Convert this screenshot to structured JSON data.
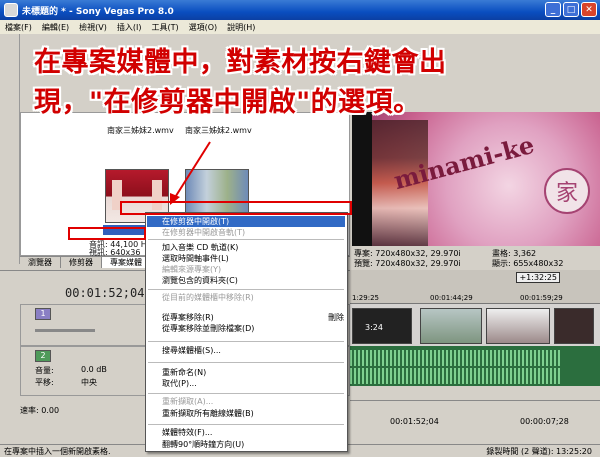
{
  "window": {
    "title": "未標題的 * - Sony Vegas Pro 8.0",
    "minimize": "_",
    "maximize": "□",
    "close": "✕"
  },
  "menubar": [
    "檔案(F)",
    "編輯(E)",
    "檢視(V)",
    "插入(I)",
    "工具(T)",
    "選項(O)",
    "說明(H)"
  ],
  "annotation": {
    "line1": "在專案媒體中，對素材按右鍵會出",
    "line2": "現，\"在修剪器中開啟\"的選項。"
  },
  "media": {
    "files": [
      "南家三姊妹2.wmv",
      "南家三姊妹2.wmv"
    ],
    "info_audio": "音訊: 44,100 H",
    "info_video": "視訊: 640x36",
    "selected_label": "南家三姊妹2"
  },
  "tabs": [
    "瀏覽器",
    "修剪器",
    "專案媒體"
  ],
  "preview": {
    "brand": "minami-ke",
    "seal": "家",
    "project": "專案: 720x480x32, 29.970i",
    "preview_res": "預覽: 720x480x32, 29.970i",
    "frame": "畫格: 3,362",
    "display": "顯示: 655x480x32"
  },
  "timeline": {
    "timecode": "00:01:52;04",
    "marker": "+1:32:25",
    "ticks": [
      "1:29:25",
      "00:01:44;29",
      "00:01:59;29"
    ],
    "clip_label": "3:24",
    "video_track_num": "1",
    "audio_track_num": "2",
    "volume_label": "音量:",
    "volume_value": "0.0 dB",
    "pan_label": "平移:",
    "pan_value": "中央",
    "rate_label": "速率: 0.00",
    "bottom_time1": "00:01:52;04",
    "bottom_time2": "00:00:07;28"
  },
  "status": {
    "left": "在專案中插入一個新開啟素格.",
    "record": "錄製時間 (2 聲道): 13:25:20"
  },
  "context_menu": {
    "items": [
      {
        "label": "在修剪器中開啟(T)",
        "state": "highlight"
      },
      {
        "label": "在修剪器中開啟音軌(T)",
        "state": "disabled"
      },
      {
        "label": "加入音樂 CD 軌道(K)",
        "state": "normal"
      },
      {
        "label": "選取時間軸事件(L)",
        "state": "normal"
      },
      {
        "label": "編輯來源專案(Y)",
        "state": "disabled"
      },
      {
        "label": "瀏覽包含的資料夾(C)",
        "state": "normal"
      },
      {
        "label": "從目前的媒體櫃中移除(R)",
        "state": "disabled"
      },
      {
        "label": "從專案移除(R)",
        "state": "normal"
      },
      {
        "label": "從專案移除並刪除檔案(D)",
        "state": "normal"
      },
      {
        "label": "搜尋媒體櫃(S)...",
        "state": "normal"
      },
      {
        "label": "重新命名(N)",
        "state": "normal"
      },
      {
        "label": "取代(P)...",
        "state": "normal"
      },
      {
        "label": "重新擷取(A)...",
        "state": "disabled"
      },
      {
        "label": "重新擷取所有離線媒體(B)",
        "state": "normal"
      },
      {
        "label": "媒體特效(F)...",
        "state": "normal"
      },
      {
        "label": "翻轉90°順時鐘方向(U)",
        "state": "normal"
      }
    ],
    "shortcut": "刪除"
  },
  "colors": {
    "highlight": "#316ac5",
    "annotation": "#d10000",
    "titlebar": "#0a4ec0"
  }
}
